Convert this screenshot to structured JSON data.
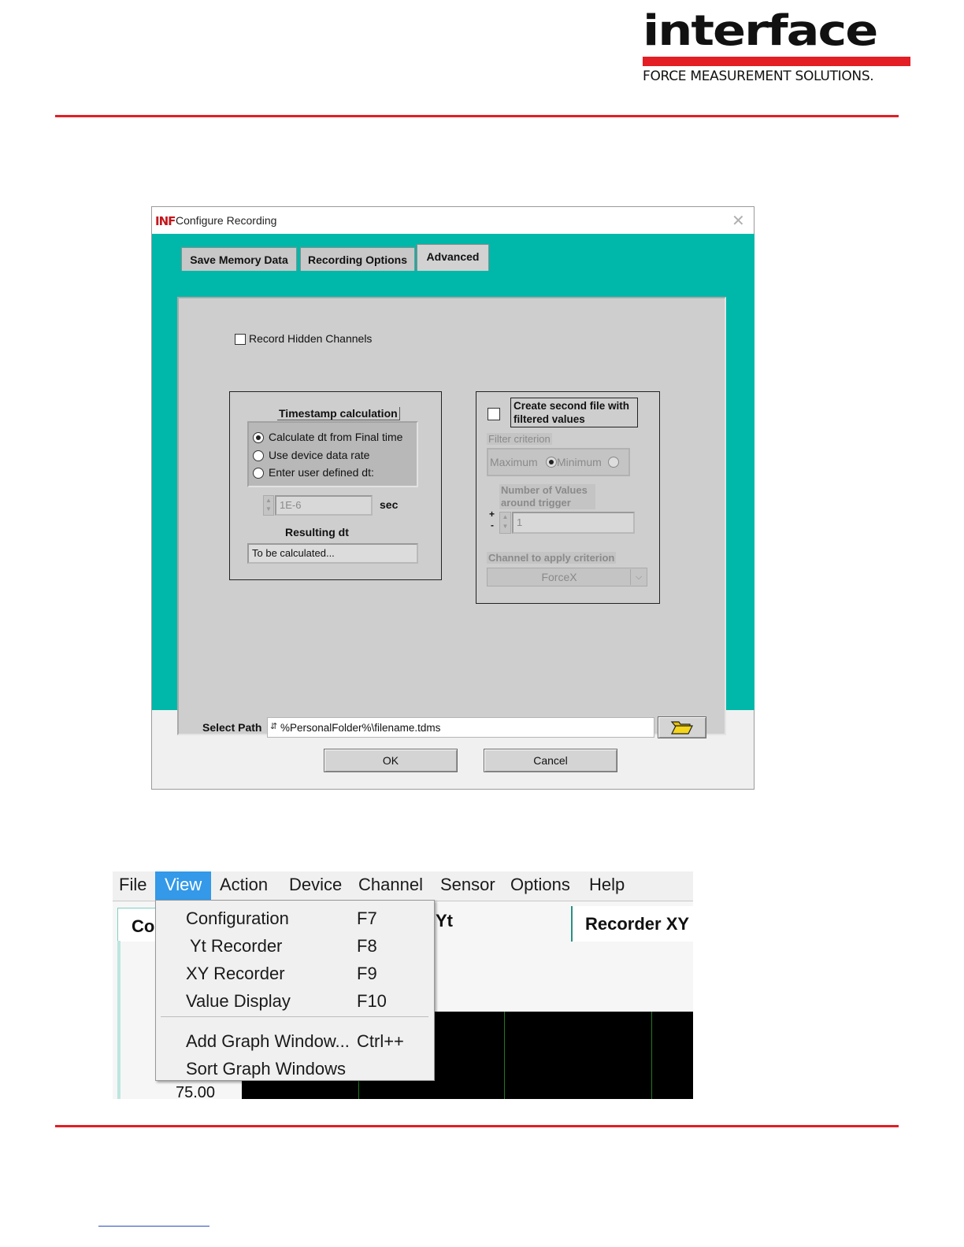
{
  "header": {
    "logo_text": "interface",
    "logo_tagline": "FORCE MEASUREMENT SOLUTIONS.",
    "colors": {
      "brand_red": "#e31e24",
      "teal": "#00b8a9",
      "menu_highlight": "#3399e8"
    }
  },
  "dialog": {
    "icon_text": "INF",
    "title": "Configure Recording",
    "close_icon": "close-icon",
    "tabs": [
      {
        "label": "Save Memory Data"
      },
      {
        "label": "Recording Options"
      },
      {
        "label": "Advanced"
      }
    ],
    "record_hidden": {
      "label": "Record Hidden Channels",
      "checked": false
    },
    "timestamp": {
      "title": "Timestamp calculation",
      "options": [
        {
          "label": "Calculate dt from Final time",
          "selected": true
        },
        {
          "label": "Use device data rate",
          "selected": false
        },
        {
          "label": "Enter user defined dt:",
          "selected": false
        }
      ],
      "dt_value": "1E-6",
      "unit": "sec",
      "resulting_label": "Resulting dt",
      "resulting_value": "To be calculated..."
    },
    "filter": {
      "checkbox_label": "Create second file with filtered values",
      "checked": false,
      "criterion_label": "Filter criterion",
      "option_max": "Maximum",
      "option_min": "Minimum",
      "count_label": "Number of Values around trigger",
      "count_value": "1",
      "plus": "+",
      "minus": "-",
      "channel_label": "Channel to apply criterion",
      "channel_value": "ForceX"
    },
    "path_label": "Select Path",
    "path_value": "%PersonalFolder%\\filename.tdms",
    "ok_label": "OK",
    "cancel_label": "Cancel"
  },
  "menu": {
    "bar": [
      "File",
      "View",
      "Action",
      "Device",
      "Channel",
      "Sensor",
      "Options",
      "Help"
    ],
    "selected": "View",
    "items": [
      {
        "label": "Configuration",
        "shortcut": "F7"
      },
      {
        "label": "Yt Recorder",
        "shortcut": "F8"
      },
      {
        "label": "XY Recorder",
        "shortcut": "F9"
      },
      {
        "label": "Value Display",
        "shortcut": "F10"
      },
      {
        "label": "Add Graph Window...",
        "shortcut": "Ctrl++"
      },
      {
        "label": "Sort Graph Windows",
        "shortcut": ""
      }
    ],
    "bg_tab_partial": "Co",
    "bg_tab_yt": "Yt",
    "bg_tab_xy": "Recorder XY",
    "axis_value": "75.00"
  }
}
